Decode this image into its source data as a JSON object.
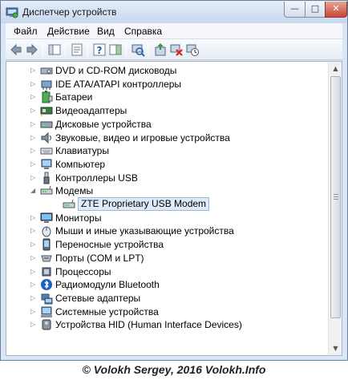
{
  "window": {
    "title": "Диспетчер устройств",
    "controls": {
      "minimize": "—",
      "maximize": "□",
      "close": "✕"
    }
  },
  "menu": [
    {
      "label": "Файл"
    },
    {
      "label": "Действие"
    },
    {
      "label": "Вид"
    },
    {
      "label": "Справка"
    }
  ],
  "toolbar": {
    "buttons": [
      "back-arrow-icon",
      "forward-arrow-icon",
      "show-hide-console-tree-icon",
      "properties-icon",
      "help-icon",
      "expand-pane-icon",
      "scan-hardware-icon",
      "update-driver-icon",
      "disable-device-icon",
      "uninstall-device-icon"
    ]
  },
  "tree": [
    {
      "label": "DVD и CD-ROM дисководы",
      "icon": "dvd-drive-icon",
      "expanded": false
    },
    {
      "label": "IDE ATA/ATAPI контроллеры",
      "icon": "ide-controller-icon",
      "expanded": false
    },
    {
      "label": "Батареи",
      "icon": "battery-icon",
      "expanded": false
    },
    {
      "label": "Видеоадаптеры",
      "icon": "display-adapter-icon",
      "expanded": false
    },
    {
      "label": "Дисковые устройства",
      "icon": "disk-drive-icon",
      "expanded": false
    },
    {
      "label": "Звуковые, видео и игровые устройства",
      "icon": "sound-icon",
      "expanded": false
    },
    {
      "label": "Клавиатуры",
      "icon": "keyboard-icon",
      "expanded": false
    },
    {
      "label": "Компьютер",
      "icon": "computer-icon",
      "expanded": false
    },
    {
      "label": "Контроллеры USB",
      "icon": "usb-controller-icon",
      "expanded": false
    },
    {
      "label": "Модемы",
      "icon": "modem-icon",
      "expanded": true
    },
    {
      "label": "ZTE Proprietary USB Modem",
      "icon": "modem-icon",
      "child": true,
      "selected": true
    },
    {
      "label": "Мониторы",
      "icon": "monitor-icon",
      "expanded": false
    },
    {
      "label": "Мыши и иные указывающие устройства",
      "icon": "mouse-icon",
      "expanded": false
    },
    {
      "label": "Переносные устройства",
      "icon": "portable-device-icon",
      "expanded": false
    },
    {
      "label": "Порты (COM и LPT)",
      "icon": "port-icon",
      "expanded": false
    },
    {
      "label": "Процессоры",
      "icon": "processor-icon",
      "expanded": false
    },
    {
      "label": "Радиомодули Bluetooth",
      "icon": "bluetooth-icon",
      "expanded": false
    },
    {
      "label": "Сетевые адаптеры",
      "icon": "network-adapter-icon",
      "expanded": false
    },
    {
      "label": "Системные устройства",
      "icon": "system-device-icon",
      "expanded": false
    },
    {
      "label": "Устройства HID (Human Interface Devices)",
      "icon": "hid-icon",
      "expanded": false
    }
  ],
  "footer": {
    "text": "© Volokh Sergey, 2016 Volokh.Info"
  },
  "colors": {
    "selection": "#dfeaf8",
    "selection_border": "#9bb8dc",
    "frame": "#d9e6f5"
  }
}
